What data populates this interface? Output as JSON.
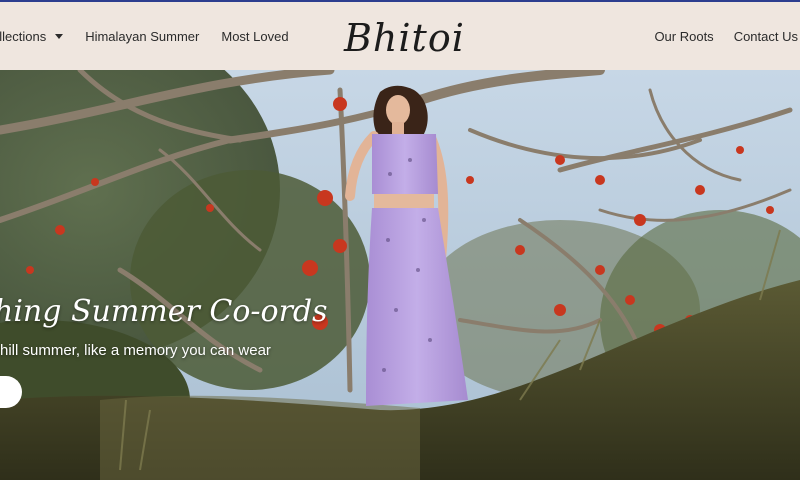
{
  "header": {
    "nav_left": [
      {
        "label": "ollections",
        "has_dropdown": true
      },
      {
        "label": "Himalayan Summer",
        "has_dropdown": false
      },
      {
        "label": "Most Loved",
        "has_dropdown": false
      }
    ],
    "logo_text": "Bhitoi",
    "nav_right": [
      {
        "label": "Our Roots"
      },
      {
        "label": "Contact Us"
      }
    ]
  },
  "hero": {
    "title": "hing Summer Co-ords",
    "subtitle": "hill summer, like a memory you can wear",
    "cta_icon": "button-pill"
  },
  "colors": {
    "header_bg": "#efe6df",
    "top_accent": "#2c3e8f",
    "dress": "#b79ee0",
    "flowers": "#c8371f",
    "sky": "#b9cde0"
  }
}
